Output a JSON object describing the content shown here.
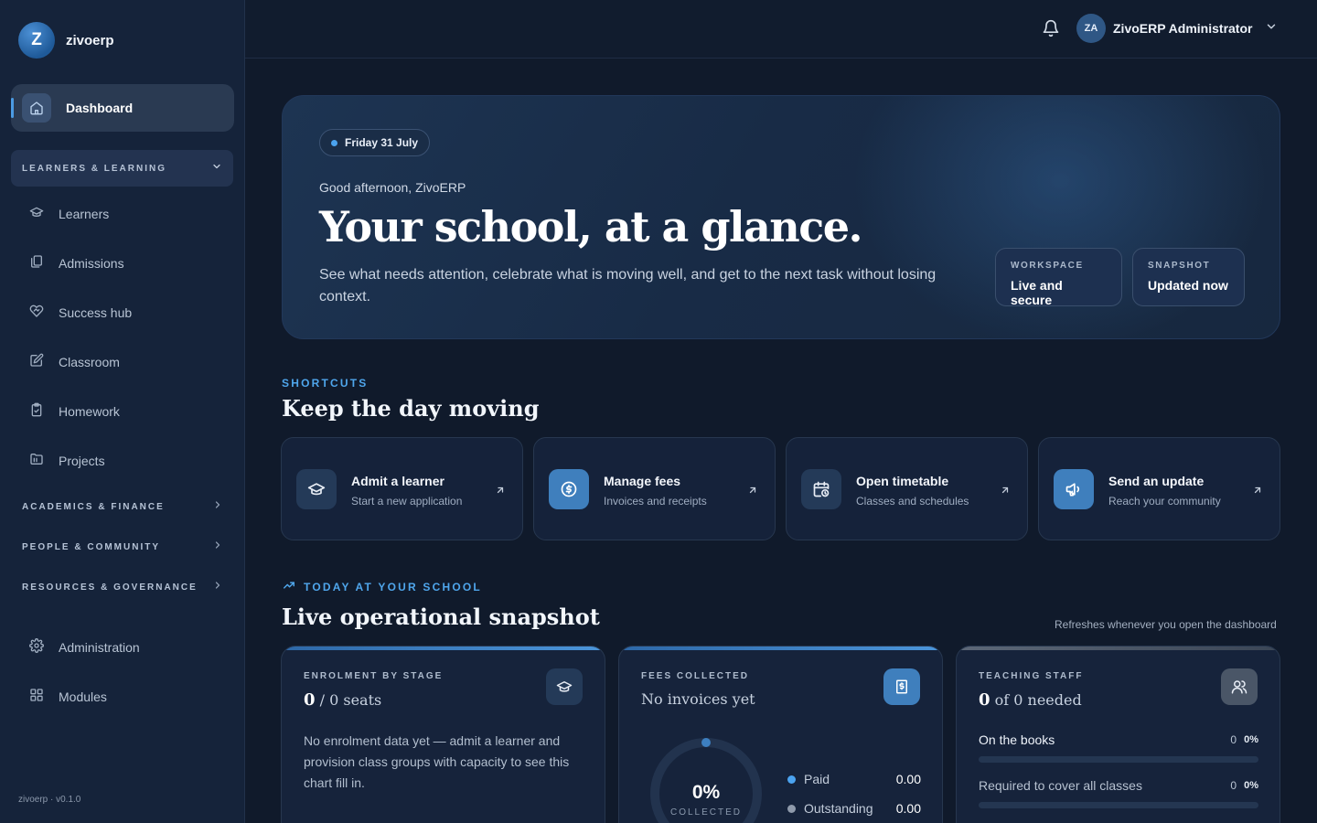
{
  "brand": {
    "initial": "Z",
    "name": "zivoerp",
    "version": "zivoerp · v0.1.0"
  },
  "sidebar": {
    "active": {
      "label": "Dashboard",
      "icon": "home-icon"
    },
    "groups": {
      "learners": "LEARNERS & LEARNING",
      "academics": "ACADEMICS & FINANCE",
      "people": "PEOPLE & COMMUNITY",
      "resources": "RESOURCES & GOVERNANCE"
    },
    "items": [
      {
        "label": "Learners",
        "icon": "graduation-cap-icon"
      },
      {
        "label": "Admissions",
        "icon": "documents-icon"
      },
      {
        "label": "Success hub",
        "icon": "heart-handshake-icon"
      },
      {
        "label": "Classroom",
        "icon": "edit-icon"
      },
      {
        "label": "Homework",
        "icon": "clipboard-icon"
      },
      {
        "label": "Projects",
        "icon": "folder-icon"
      }
    ],
    "bottom": [
      {
        "label": "Administration",
        "icon": "gear-icon"
      },
      {
        "label": "Modules",
        "icon": "grid-icon"
      }
    ]
  },
  "topbar": {
    "user_initials": "ZA",
    "user_name": "ZivoERP Administrator"
  },
  "hero": {
    "date": "Friday 31 July",
    "greeting": "Good afternoon, ZivoERP",
    "title": "Your school, at a glance.",
    "subtitle": "See what needs attention, celebrate what is moving well, and get to the next task without losing context.",
    "chips": [
      {
        "key": "WORKSPACE",
        "value": "Live and secure"
      },
      {
        "key": "SNAPSHOT",
        "value": "Updated now"
      }
    ]
  },
  "shortcuts": {
    "eyebrow": "SHORTCUTS",
    "title": "Keep the day moving",
    "items": [
      {
        "title": "Admit a learner",
        "subtitle": "Start a new application",
        "icon": "graduation-cap-icon"
      },
      {
        "title": "Manage fees",
        "subtitle": "Invoices and receipts",
        "icon": "dollar-coin-icon"
      },
      {
        "title": "Open timetable",
        "subtitle": "Classes and schedules",
        "icon": "calendar-clock-icon"
      },
      {
        "title": "Send an update",
        "subtitle": "Reach your community",
        "icon": "megaphone-icon"
      }
    ]
  },
  "snapshot": {
    "eyebrow": "TODAY AT YOUR SCHOOL",
    "title": "Live operational snapshot",
    "note": "Refreshes whenever you open the dashboard",
    "enrolment": {
      "key": "ENROLMENT BY STAGE",
      "value": "0",
      "suffix": " / 0 seats",
      "desc": "No enrolment data yet — admit a learner and provision class groups with capacity to see this chart fill in."
    },
    "fees": {
      "key": "FEES COLLECTED",
      "value": "No invoices yet",
      "percent": "0%",
      "percent_label": "COLLECTED",
      "collected_fraction": 0,
      "legend": [
        {
          "label": "Paid",
          "value": "0.00",
          "color": "#4ba3ef"
        },
        {
          "label": "Outstanding",
          "value": "0.00",
          "color": "#8f9aab"
        }
      ]
    },
    "staff": {
      "key": "TEACHING STAFF",
      "value": "0",
      "suffix": " of 0 needed",
      "rows": [
        {
          "label": "On the books",
          "count": "0",
          "percent": "0%",
          "fraction": 0
        },
        {
          "label": "Required to cover all classes",
          "count": "0",
          "percent": "0%",
          "fraction": 0
        }
      ]
    }
  }
}
